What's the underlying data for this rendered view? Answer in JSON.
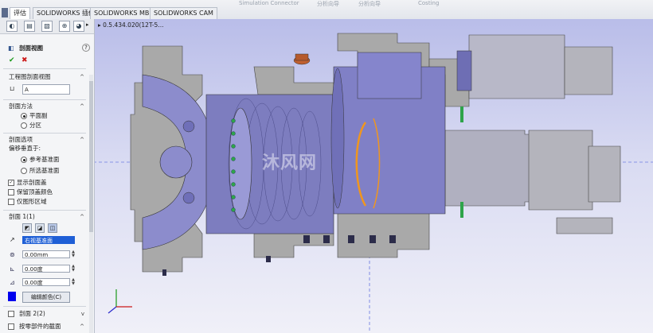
{
  "tabbar": {
    "tabs": [
      {
        "label": "评估",
        "active": true
      },
      {
        "label": "SOLIDWORKS 插件",
        "active": false
      },
      {
        "label": "SOLIDWORKS MBD",
        "active": false
      },
      {
        "label": "SOLIDWORKS CAM",
        "active": false
      }
    ],
    "faded_labels": [
      "Simulation Connector",
      "分析向导",
      "分析向导",
      "Costing"
    ]
  },
  "panel": {
    "title": "剖面视图",
    "help_icon": "?",
    "ok_icon": "✔",
    "cancel_icon": "✖",
    "section_drawing": {
      "title": "工程图剖面视图",
      "label_value": "A"
    },
    "section_method": {
      "title": "剖面方法",
      "options": [
        {
          "label": "平面副",
          "selected": true
        },
        {
          "label": "分区",
          "selected": false
        }
      ]
    },
    "section_options": {
      "title": "剖面选项",
      "offset_label": "偏移垂直于:",
      "offset_options": [
        {
          "label": "参考基准面",
          "selected": true
        },
        {
          "label": "所选基准面",
          "selected": false
        }
      ],
      "checkboxes": [
        {
          "label": "显示剖面盖",
          "checked": true
        },
        {
          "label": "保留顶盖颜色",
          "checked": false
        },
        {
          "label": "仅图形区域",
          "checked": false
        }
      ]
    },
    "section1": {
      "title": "剖面 1(1)",
      "plane_value": "右视基准面",
      "offset_value": "0.00mm",
      "angle_x_value": "0.00度",
      "angle_y_value": "0.00度",
      "edit_color_label": "编辑颜色(C)",
      "cap_color": "#0000ee"
    },
    "section2": {
      "title": "剖面 2(2)"
    },
    "by_component": {
      "title": "按零部件的截面"
    }
  },
  "viewport": {
    "breadcrumb": "0.5.434.020(12T-5...",
    "watermark": "沐风网",
    "background_top": "#b9bde9",
    "background_bottom": "#f0f0f8",
    "cut_face_color": "#a9a9a9",
    "body_color": "#8c8ccc",
    "ring_color": "#f0961e"
  }
}
